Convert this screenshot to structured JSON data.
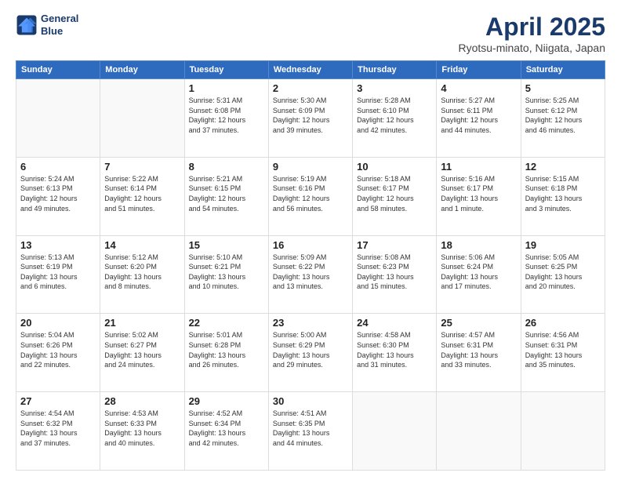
{
  "header": {
    "logo_line1": "General",
    "logo_line2": "Blue",
    "title": "April 2025",
    "subtitle": "Ryotsu-minato, Niigata, Japan"
  },
  "weekdays": [
    "Sunday",
    "Monday",
    "Tuesday",
    "Wednesday",
    "Thursday",
    "Friday",
    "Saturday"
  ],
  "weeks": [
    [
      {
        "day": "",
        "info": ""
      },
      {
        "day": "",
        "info": ""
      },
      {
        "day": "1",
        "info": "Sunrise: 5:31 AM\nSunset: 6:08 PM\nDaylight: 12 hours\nand 37 minutes."
      },
      {
        "day": "2",
        "info": "Sunrise: 5:30 AM\nSunset: 6:09 PM\nDaylight: 12 hours\nand 39 minutes."
      },
      {
        "day": "3",
        "info": "Sunrise: 5:28 AM\nSunset: 6:10 PM\nDaylight: 12 hours\nand 42 minutes."
      },
      {
        "day": "4",
        "info": "Sunrise: 5:27 AM\nSunset: 6:11 PM\nDaylight: 12 hours\nand 44 minutes."
      },
      {
        "day": "5",
        "info": "Sunrise: 5:25 AM\nSunset: 6:12 PM\nDaylight: 12 hours\nand 46 minutes."
      }
    ],
    [
      {
        "day": "6",
        "info": "Sunrise: 5:24 AM\nSunset: 6:13 PM\nDaylight: 12 hours\nand 49 minutes."
      },
      {
        "day": "7",
        "info": "Sunrise: 5:22 AM\nSunset: 6:14 PM\nDaylight: 12 hours\nand 51 minutes."
      },
      {
        "day": "8",
        "info": "Sunrise: 5:21 AM\nSunset: 6:15 PM\nDaylight: 12 hours\nand 54 minutes."
      },
      {
        "day": "9",
        "info": "Sunrise: 5:19 AM\nSunset: 6:16 PM\nDaylight: 12 hours\nand 56 minutes."
      },
      {
        "day": "10",
        "info": "Sunrise: 5:18 AM\nSunset: 6:17 PM\nDaylight: 12 hours\nand 58 minutes."
      },
      {
        "day": "11",
        "info": "Sunrise: 5:16 AM\nSunset: 6:17 PM\nDaylight: 13 hours\nand 1 minute."
      },
      {
        "day": "12",
        "info": "Sunrise: 5:15 AM\nSunset: 6:18 PM\nDaylight: 13 hours\nand 3 minutes."
      }
    ],
    [
      {
        "day": "13",
        "info": "Sunrise: 5:13 AM\nSunset: 6:19 PM\nDaylight: 13 hours\nand 6 minutes."
      },
      {
        "day": "14",
        "info": "Sunrise: 5:12 AM\nSunset: 6:20 PM\nDaylight: 13 hours\nand 8 minutes."
      },
      {
        "day": "15",
        "info": "Sunrise: 5:10 AM\nSunset: 6:21 PM\nDaylight: 13 hours\nand 10 minutes."
      },
      {
        "day": "16",
        "info": "Sunrise: 5:09 AM\nSunset: 6:22 PM\nDaylight: 13 hours\nand 13 minutes."
      },
      {
        "day": "17",
        "info": "Sunrise: 5:08 AM\nSunset: 6:23 PM\nDaylight: 13 hours\nand 15 minutes."
      },
      {
        "day": "18",
        "info": "Sunrise: 5:06 AM\nSunset: 6:24 PM\nDaylight: 13 hours\nand 17 minutes."
      },
      {
        "day": "19",
        "info": "Sunrise: 5:05 AM\nSunset: 6:25 PM\nDaylight: 13 hours\nand 20 minutes."
      }
    ],
    [
      {
        "day": "20",
        "info": "Sunrise: 5:04 AM\nSunset: 6:26 PM\nDaylight: 13 hours\nand 22 minutes."
      },
      {
        "day": "21",
        "info": "Sunrise: 5:02 AM\nSunset: 6:27 PM\nDaylight: 13 hours\nand 24 minutes."
      },
      {
        "day": "22",
        "info": "Sunrise: 5:01 AM\nSunset: 6:28 PM\nDaylight: 13 hours\nand 26 minutes."
      },
      {
        "day": "23",
        "info": "Sunrise: 5:00 AM\nSunset: 6:29 PM\nDaylight: 13 hours\nand 29 minutes."
      },
      {
        "day": "24",
        "info": "Sunrise: 4:58 AM\nSunset: 6:30 PM\nDaylight: 13 hours\nand 31 minutes."
      },
      {
        "day": "25",
        "info": "Sunrise: 4:57 AM\nSunset: 6:31 PM\nDaylight: 13 hours\nand 33 minutes."
      },
      {
        "day": "26",
        "info": "Sunrise: 4:56 AM\nSunset: 6:31 PM\nDaylight: 13 hours\nand 35 minutes."
      }
    ],
    [
      {
        "day": "27",
        "info": "Sunrise: 4:54 AM\nSunset: 6:32 PM\nDaylight: 13 hours\nand 37 minutes."
      },
      {
        "day": "28",
        "info": "Sunrise: 4:53 AM\nSunset: 6:33 PM\nDaylight: 13 hours\nand 40 minutes."
      },
      {
        "day": "29",
        "info": "Sunrise: 4:52 AM\nSunset: 6:34 PM\nDaylight: 13 hours\nand 42 minutes."
      },
      {
        "day": "30",
        "info": "Sunrise: 4:51 AM\nSunset: 6:35 PM\nDaylight: 13 hours\nand 44 minutes."
      },
      {
        "day": "",
        "info": ""
      },
      {
        "day": "",
        "info": ""
      },
      {
        "day": "",
        "info": ""
      }
    ]
  ]
}
